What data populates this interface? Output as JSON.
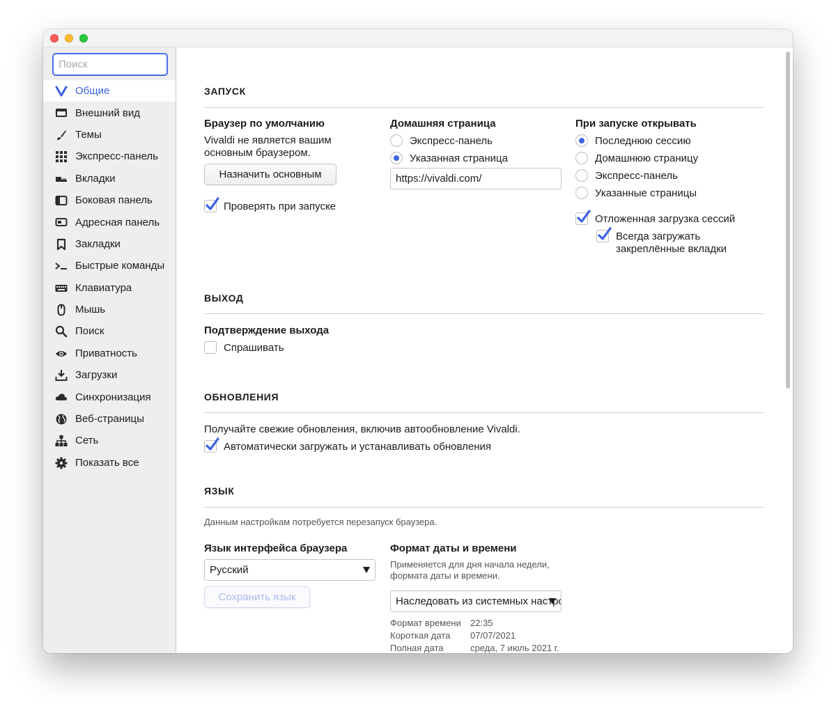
{
  "sidebar": {
    "search_placeholder": "Поиск",
    "items": [
      {
        "label": "Общие",
        "icon": "vivaldi-logo-icon"
      },
      {
        "label": "Внешний вид",
        "icon": "folder-icon"
      },
      {
        "label": "Темы",
        "icon": "brush-icon"
      },
      {
        "label": "Экспресс-панель",
        "icon": "grid-icon"
      },
      {
        "label": "Вкладки",
        "icon": "tabs-icon"
      },
      {
        "label": "Боковая панель",
        "icon": "panel-icon"
      },
      {
        "label": "Адресная панель",
        "icon": "address-bar-icon"
      },
      {
        "label": "Закладки",
        "icon": "bookmark-icon"
      },
      {
        "label": "Быстрые команды",
        "icon": "terminal-icon"
      },
      {
        "label": "Клавиатура",
        "icon": "keyboard-icon"
      },
      {
        "label": "Мышь",
        "icon": "mouse-icon"
      },
      {
        "label": "Поиск",
        "icon": "search-icon"
      },
      {
        "label": "Приватность",
        "icon": "eye-icon"
      },
      {
        "label": "Загрузки",
        "icon": "download-icon"
      },
      {
        "label": "Синхронизация",
        "icon": "cloud-icon"
      },
      {
        "label": "Веб-страницы",
        "icon": "globe-icon"
      },
      {
        "label": "Сеть",
        "icon": "network-icon"
      },
      {
        "label": "Показать все",
        "icon": "gear-icon"
      }
    ]
  },
  "startup": {
    "title": "ЗАПУСК",
    "default_browser": {
      "heading": "Браузер по умолчанию",
      "status_line1": "Vivaldi не является вашим",
      "status_line2": "основным браузером.",
      "button": "Назначить основным",
      "check_label": "Проверять при запуске",
      "check_on": true
    },
    "homepage": {
      "heading": "Домашняя страница",
      "options": [
        "Экспресс-панель",
        "Указанная страница"
      ],
      "selected": 1,
      "url": "https://vivaldi.com/"
    },
    "on_start": {
      "heading": "При запуске открывать",
      "options": [
        "Последнюю сессию",
        "Домашнюю страницу",
        "Экспресс-панель",
        "Указанные страницы"
      ],
      "selected": 0,
      "lazy_load_label": "Отложенная загрузка сессий",
      "pinned_line1": "Всегда загружать",
      "pinned_line2": "закреплённые вкладки"
    }
  },
  "exit": {
    "title": "ВЫХОД",
    "heading": "Подтверждение выхода",
    "ask_label": "Спрашивать",
    "ask_on": false
  },
  "updates": {
    "title": "ОБНОВЛЕНИЯ",
    "description": "Получайте свежие обновления, включив автообновление Vivaldi.",
    "auto_label": "Автоматически загружать и устанавливать обновления",
    "auto_on": true
  },
  "language": {
    "title": "ЯЗЫК",
    "note": "Данным настройкам потребуется перезапуск браузера.",
    "ui_lang_heading": "Язык интерфейса браузера",
    "ui_lang_value": "Русский",
    "save_button": "Сохранить язык",
    "datetime_heading": "Формат даты и времени",
    "datetime_desc_line1": "Применяется для дня начала недели,",
    "datetime_desc_line2": "формата даты и времени.",
    "datetime_value": "Наследовать из системных настроек",
    "rows": [
      {
        "label": "Формат времени",
        "value": "22:35"
      },
      {
        "label": "Короткая дата",
        "value": "07/07/2021"
      },
      {
        "label": "Полная дата",
        "value": "среда, 7 июль 2021 г."
      }
    ]
  },
  "colors": {
    "accent": "#3d62e4",
    "sidebar_bg": "#eeeeee"
  }
}
